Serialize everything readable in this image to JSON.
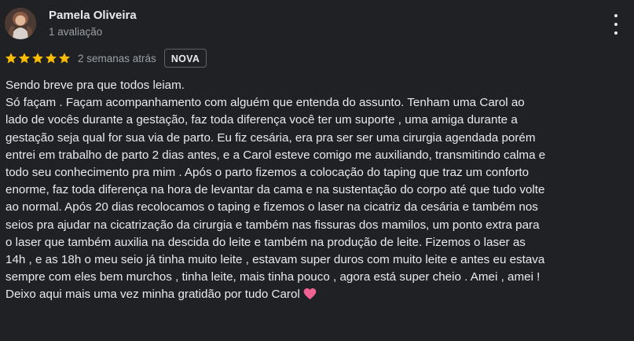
{
  "review": {
    "author": {
      "name": "Pamela Oliveira",
      "meta": "1 avaliação",
      "avatar_icon": "profile-photo"
    },
    "rating": {
      "stars": 5,
      "max_stars": 5,
      "star_color": "#fbbc04"
    },
    "time": "2 semanas atrás",
    "badge": "NOVA",
    "more_icon": "more-vert-icon",
    "text": "Sendo breve pra que todos leiam.\nSó façam . Façam acompanhamento com alguém que entenda do assunto. Tenham uma Carol ao\nlado de vocês durante a gestação, faz toda diferença você ter um suporte , uma amiga durante a\ngestação seja qual for sua via de parto. Eu fiz cesária, era pra ser ser uma cirurgia agendada porém\nentrei em trabalho de parto 2 dias antes, e a Carol esteve comigo me auxiliando, transmitindo calma e\ntodo seu conhecimento pra mim . Após o parto fizemos a colocação do taping que traz um conforto\nenorme, faz toda diferença na hora de levantar da cama e na sustentação do corpo até que tudo volte\nao normal. Após 20 dias recolocamos o taping e fizemos o laser na cicatriz da cesária e também nos\nseios pra ajudar na cicatrização da cirurgia e também nas fissuras dos mamilos, um ponto extra para\no laser que também auxilia na descida do leite e também na produção de leite. Fizemos o laser as\n14h , e as 18h o meu seio já tinha muito leite , estavam super duros com muito leite e antes eu estava\nsempre com eles bem murchos , tinha leite, mais tinha pouco , agora está super cheio . Amei , amei !\nDeixo aqui mais uma vez minha gratidão por tudo Carol",
    "emoji": "💗",
    "emoji_color": "#f06292"
  }
}
